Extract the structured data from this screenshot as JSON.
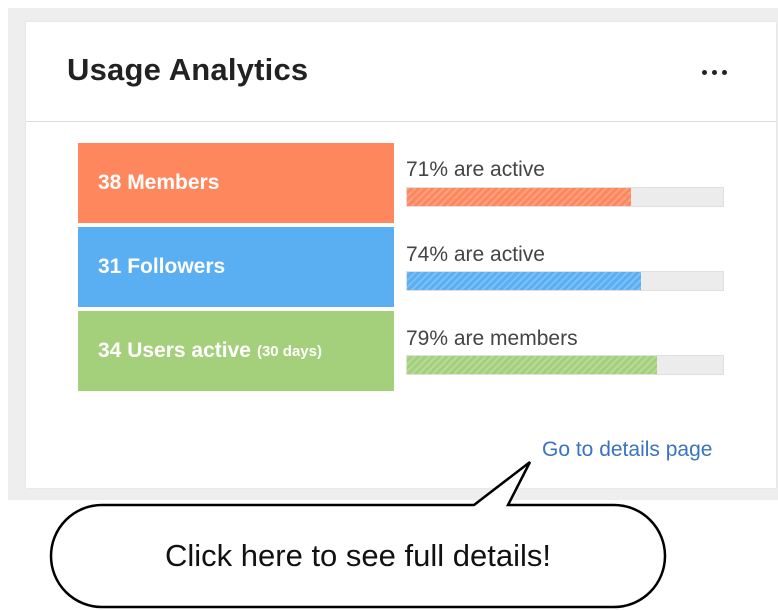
{
  "widget": {
    "title": "Usage Analytics",
    "menu_icon": "more-horizontal-icon"
  },
  "rows": [
    {
      "stat": "38 Members",
      "stat_suffix": "",
      "label": "71% are active",
      "percent": 71,
      "color": "#ff875e"
    },
    {
      "stat": "31 Followers",
      "stat_suffix": "",
      "label": "74% are active",
      "percent": 74,
      "color": "#5aaef2"
    },
    {
      "stat": "34 Users active",
      "stat_suffix": "(30 days)",
      "label": "79% are members",
      "percent": 79,
      "color": "#a4d07b"
    }
  ],
  "footer": {
    "link_text": "Go to details page",
    "link_color": "#3a73c0"
  },
  "callout": {
    "text": "Click here to see full details!"
  }
}
